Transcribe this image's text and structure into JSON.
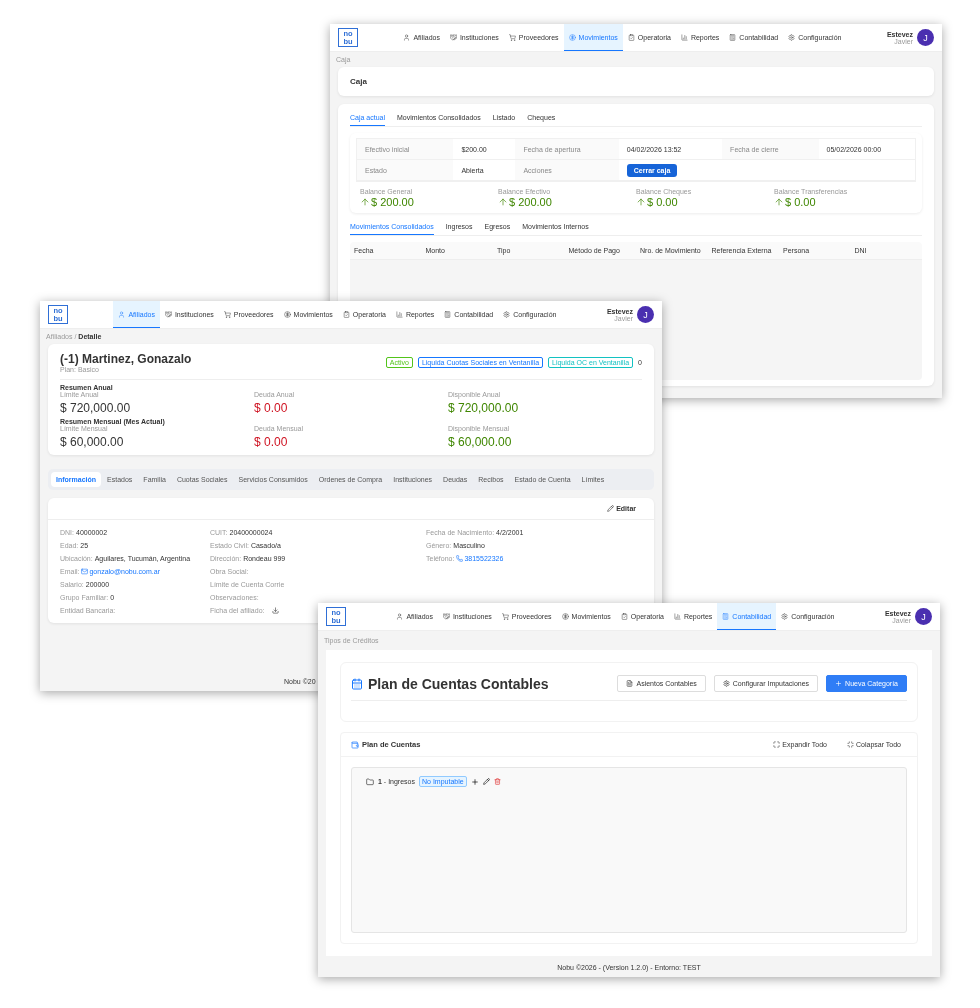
{
  "caja_window": {
    "logo": [
      "no",
      "bu"
    ],
    "nav": [
      {
        "label": "Afiliados",
        "selected": false
      },
      {
        "label": "Instituciones",
        "selected": false
      },
      {
        "label": "Proveedores",
        "selected": false
      },
      {
        "label": "Movimientos",
        "selected": true
      },
      {
        "label": "Operatoria",
        "selected": false
      },
      {
        "label": "Reportes",
        "selected": false
      },
      {
        "label": "Contabilidad",
        "selected": false
      },
      {
        "label": "Configuración",
        "selected": false
      }
    ],
    "user": {
      "name": "Estevez",
      "role": "Javier",
      "initial": "J"
    },
    "breadcrumb": "Caja",
    "title": "Caja",
    "tabs": [
      {
        "label": "Caja actual",
        "selected": true
      },
      {
        "label": "Movimientos Consolidados",
        "selected": false
      },
      {
        "label": "Listado",
        "selected": false
      },
      {
        "label": "Cheques",
        "selected": false
      }
    ],
    "info_rows": [
      [
        {
          "kind": "label",
          "text": "Efectivo inicial"
        },
        {
          "kind": "value",
          "text": "$200.00"
        },
        {
          "kind": "label",
          "text": "Fecha de apertura"
        },
        {
          "kind": "value",
          "text": "04/02/2026 13:52"
        },
        {
          "kind": "label",
          "text": "Fecha de cierre"
        },
        {
          "kind": "value",
          "text": "05/02/2026 00:00"
        }
      ],
      [
        {
          "kind": "label",
          "text": "Estado"
        },
        {
          "kind": "value",
          "text": "Abierta"
        },
        {
          "kind": "label",
          "text": "Acciones"
        },
        {
          "kind": "button",
          "text": "Cerrar caja"
        }
      ]
    ],
    "balances": [
      {
        "label": "Balance General",
        "value": "$ 200.00"
      },
      {
        "label": "Balance Efectivo",
        "value": "$ 200.00"
      },
      {
        "label": "Balance Cheques",
        "value": "$ 0.00"
      },
      {
        "label": "Balance Transferencias",
        "value": "$ 0.00"
      }
    ],
    "movement_tabs": [
      {
        "label": "Movimientos Consolidados",
        "selected": true
      },
      {
        "label": "Ingresos",
        "selected": false
      },
      {
        "label": "Egresos",
        "selected": false
      },
      {
        "label": "Movimientos Internos",
        "selected": false
      }
    ],
    "table": {
      "columns": [
        "Fecha",
        "Monto",
        "Tipo",
        "Método de Pago",
        "Nro. de Movimiento",
        "Referencia Externa",
        "Persona",
        "DNI"
      ]
    }
  },
  "afiliado_window": {
    "logo": [
      "no",
      "bu"
    ],
    "nav": [
      {
        "label": "Afiliados",
        "selected": true
      },
      {
        "label": "Instituciones",
        "selected": false
      },
      {
        "label": "Proveedores",
        "selected": false
      },
      {
        "label": "Movimientos",
        "selected": false
      },
      {
        "label": "Operatoria",
        "selected": false
      },
      {
        "label": "Reportes",
        "selected": false
      },
      {
        "label": "Contabilidad",
        "selected": false
      },
      {
        "label": "Configuración",
        "selected": false
      }
    ],
    "user": {
      "name": "Estevez",
      "role": "Javier",
      "initial": "J"
    },
    "breadcrumb": {
      "items": [
        "Afiliados",
        "Detalle"
      ],
      "separator": "/"
    },
    "name": "(-1) Martinez, Gonazalo",
    "plan": "Plan: Basico",
    "tags": [
      {
        "text": "Activo",
        "color": "#52c41a"
      },
      {
        "text": "Liquida Cuotas Sociales en Ventanilla",
        "color": "#1677ff"
      },
      {
        "text": "Liquida OC en Ventanilla",
        "color": "#13c2c2"
      }
    ],
    "count": "0",
    "summaries": [
      {
        "title": "Resumen Anual",
        "items": [
          {
            "label": "Límite Anual",
            "value": "$ 720,000.00",
            "color": "#333333"
          },
          {
            "label": "Deuda Anual",
            "value": "$ 0.00",
            "color": "#cf1322"
          },
          {
            "label": "Disponible Anual",
            "value": "$ 720,000.00",
            "color": "#3f8600"
          }
        ]
      },
      {
        "title": "Resumen Mensual (Mes Actual)",
        "items": [
          {
            "label": "Límite Mensual",
            "value": "$ 60,000.00",
            "color": "#333333"
          },
          {
            "label": "Deuda Mensual",
            "value": "$ 0.00",
            "color": "#cf1322"
          },
          {
            "label": "Disponible Mensual",
            "value": "$ 60,000.00",
            "color": "#3f8600"
          }
        ]
      }
    ],
    "tabs": [
      {
        "label": "Información",
        "selected": true
      },
      {
        "label": "Estados",
        "selected": false
      },
      {
        "label": "Familia",
        "selected": false
      },
      {
        "label": "Cuotas Sociales",
        "selected": false
      },
      {
        "label": "Servicios Consumidos",
        "selected": false
      },
      {
        "label": "Ordenes de Compra",
        "selected": false
      },
      {
        "label": "Instituciones",
        "selected": false
      },
      {
        "label": "Deudas",
        "selected": false
      },
      {
        "label": "Recibos",
        "selected": false
      },
      {
        "label": "Estado de Cuenta",
        "selected": false
      },
      {
        "label": "Límites",
        "selected": false
      }
    ],
    "edit_button": "Editar",
    "field_columns": [
      [
        {
          "kind": "text",
          "label": "DNI:",
          "value": "40000002"
        },
        {
          "kind": "text",
          "label": "Edad:",
          "value": "25"
        },
        {
          "kind": "text",
          "label": "Ubicación:",
          "value": "Aguilares, Tucumán, Argentina"
        },
        {
          "kind": "email",
          "label": "Email:",
          "value": "gonzalo@nobu.com.ar"
        },
        {
          "kind": "text",
          "label": "Salario:",
          "value": "200000"
        },
        {
          "kind": "text",
          "label": "Grupo Familiar:",
          "value": "0"
        },
        {
          "kind": "text",
          "label": "Entidad Bancaria:"
        }
      ],
      [
        {
          "kind": "text",
          "label": "CUIT:",
          "value": "20400000024"
        },
        {
          "kind": "text",
          "label": "Estado Civil:",
          "value": "Casado/a"
        },
        {
          "kind": "text",
          "label": "Dirección:",
          "value": "Rondeau 999"
        },
        {
          "kind": "text",
          "label": "Obra Social:"
        },
        {
          "kind": "text",
          "label": "Límite de Cuenta Corrie"
        },
        {
          "kind": "text",
          "label": "Observaciones:"
        },
        {
          "kind": "download",
          "label": "Ficha del afiliado:"
        }
      ],
      [
        {
          "kind": "text",
          "label": "Fecha de Nacimiento:",
          "value": "4/2/2001"
        },
        {
          "kind": "text",
          "label": "Género:",
          "value": "Masculino"
        },
        {
          "kind": "phone",
          "label": "Teléfono:",
          "value": "3815522326"
        }
      ]
    ],
    "footer": "Nobu ©20"
  },
  "plan_window": {
    "logo": [
      "no",
      "bu"
    ],
    "nav": [
      {
        "label": "Afiliados",
        "selected": false
      },
      {
        "label": "Instituciones",
        "selected": false
      },
      {
        "label": "Proveedores",
        "selected": false
      },
      {
        "label": "Movimientos",
        "selected": false
      },
      {
        "label": "Operatoria",
        "selected": false
      },
      {
        "label": "Reportes",
        "selected": false
      },
      {
        "label": "Contabilidad",
        "selected": true
      },
      {
        "label": "Configuración",
        "selected": false
      }
    ],
    "user": {
      "name": "Estevez",
      "role": "Javier",
      "initial": "J"
    },
    "breadcrumb": "Tipos de Créditos",
    "title": "Plan de Cuentas Contables",
    "buttons": [
      {
        "kind": "default",
        "label": "Asientos Contables"
      },
      {
        "kind": "default",
        "label": "Configurar Imputaciones"
      },
      {
        "kind": "primary",
        "label": "Nueva Categoría"
      }
    ],
    "section_title": "Plan de Cuentas",
    "section_actions": [
      "Expandir Todo",
      "Colapsar Todo"
    ],
    "tree": [
      {
        "code": "1",
        "name": "- Ingresos",
        "tag": "No Imputable"
      }
    ],
    "footer": "Nobu ©2026 - (Version 1.2.0) - Entorno: TEST"
  }
}
